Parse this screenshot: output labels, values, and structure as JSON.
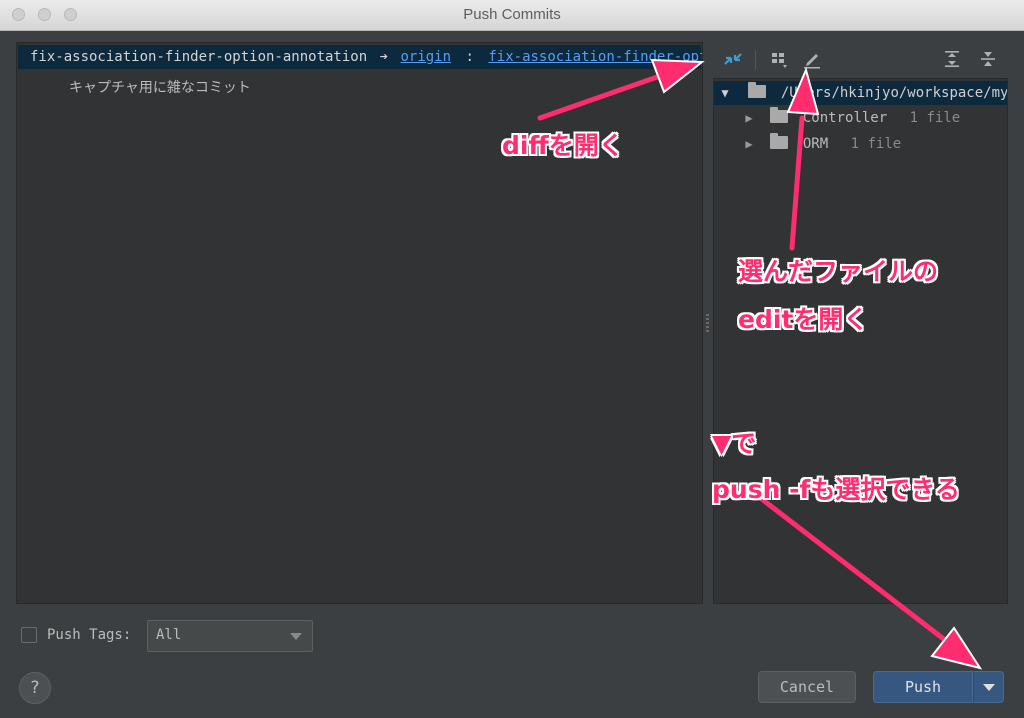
{
  "window": {
    "title": "Push Commits"
  },
  "commit": {
    "branch": "fix-association-finder-option-annotation",
    "arrow": "➔",
    "remote": "origin",
    "separator": ":",
    "target": "fix-association-finder-option-",
    "message": "キャプチャ用に雑なコミット"
  },
  "toolbar": {
    "diff_icon": "show-diff-icon",
    "group_icon": "group-by-icon",
    "edit_icon": "edit-source-icon",
    "expand_icon": "expand-all-icon",
    "collapse_icon": "collapse-all-icon"
  },
  "tree": {
    "root": "/Users/hkinjyo/workspace/my/ca",
    "items": [
      {
        "name": "Controller",
        "count": "1 file"
      },
      {
        "name": "ORM",
        "count": "1 file"
      }
    ]
  },
  "options": {
    "push_tags_label": "Push Tags:",
    "push_tags_value": "All"
  },
  "buttons": {
    "help": "?",
    "cancel": "Cancel",
    "push": "Push"
  },
  "annotations": {
    "diff": "diffを開く",
    "edit_line1": "選んだファイルの",
    "edit_line2": "editを開く",
    "push_line1": "▼で",
    "push_line2": "push -fも選択できる"
  },
  "colors": {
    "annotation": "#ff2d6f",
    "selection": "#0d293e",
    "link": "#589df6",
    "push_button": "#365880"
  }
}
